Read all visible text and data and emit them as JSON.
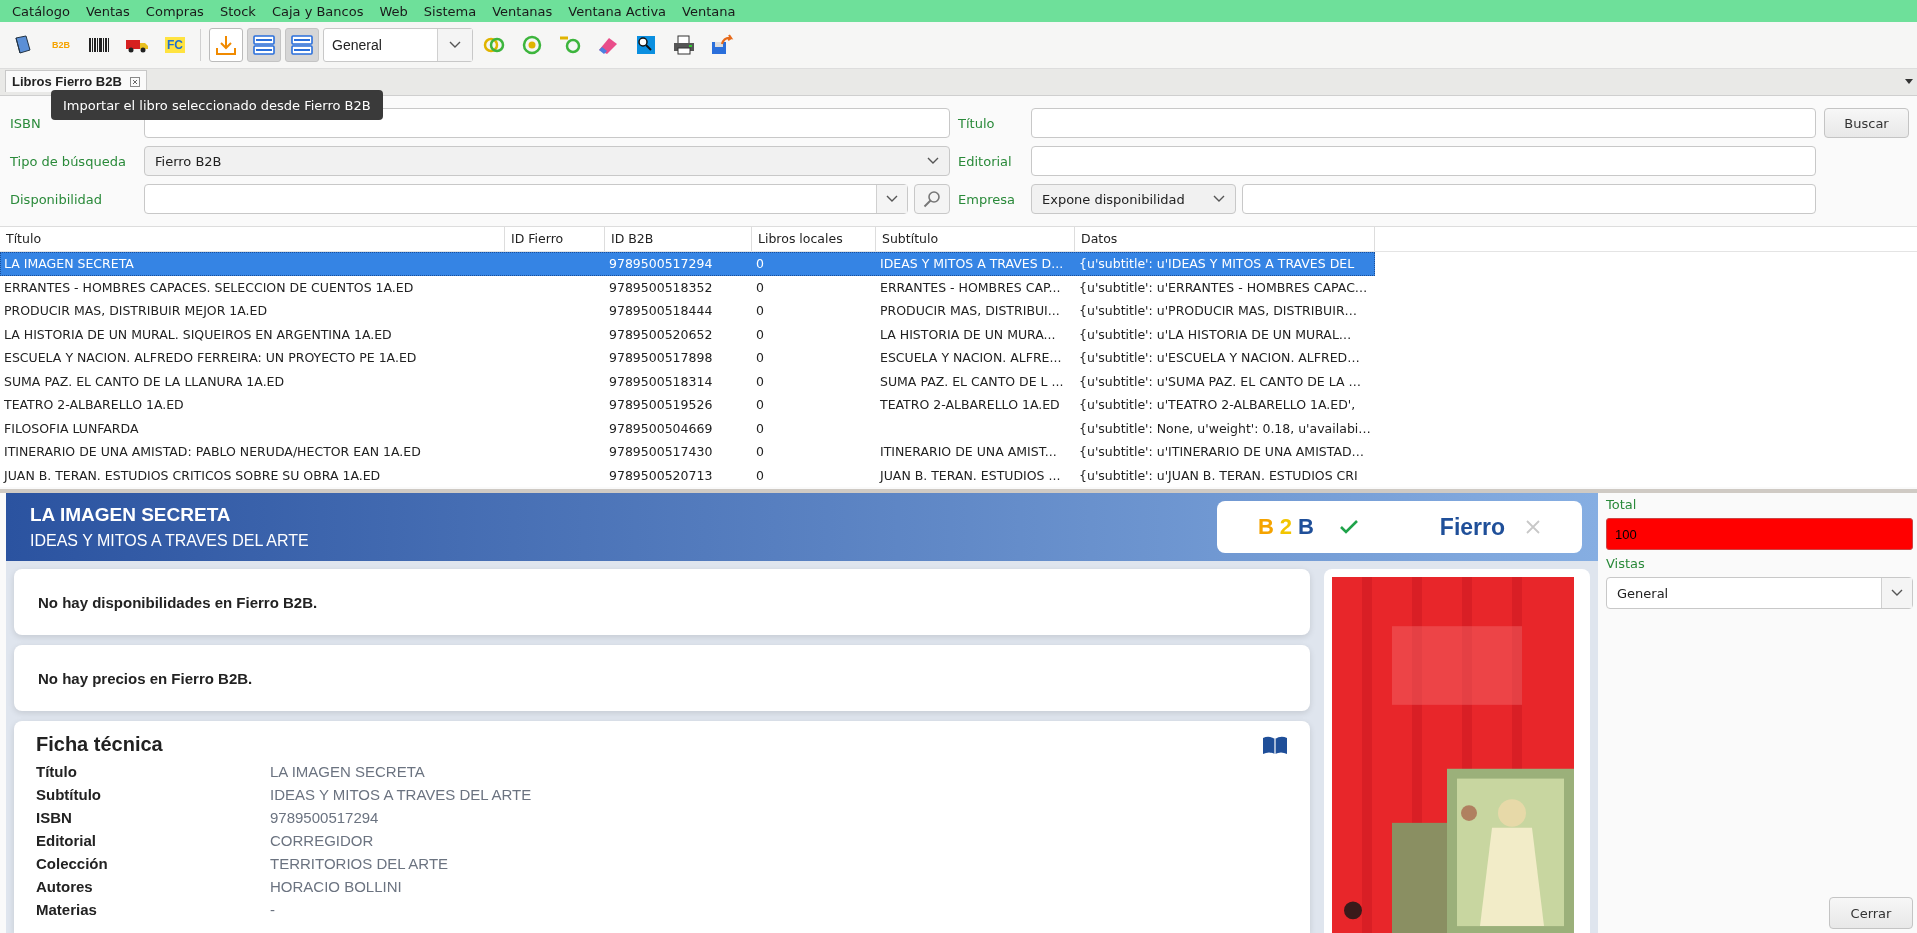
{
  "menu": [
    "Catálogo",
    "Ventas",
    "Compras",
    "Stock",
    "Caja y Bancos",
    "Web",
    "Sistema",
    "Ventanas",
    "Ventana Activa",
    "Ventana"
  ],
  "toolbar": {
    "groups": [
      [
        {
          "kind": "book",
          "pressed": false,
          "hovered": false
        },
        {
          "kind": "b2b",
          "label": "B2B",
          "pressed": false,
          "hovered": false
        },
        {
          "kind": "barcode",
          "pressed": false,
          "hovered": false
        },
        {
          "kind": "truck",
          "pressed": false,
          "hovered": false
        },
        {
          "kind": "fc",
          "label": "FC",
          "pressed": false,
          "hovered": false
        }
      ],
      [
        {
          "kind": "import",
          "pressed": false,
          "hovered": true
        },
        {
          "kind": "rows",
          "pressed": true,
          "hovered": false
        },
        {
          "kind": "rows",
          "pressed": true,
          "hovered": false
        },
        {
          "kind": "combo",
          "value": "General"
        },
        {
          "kind": "rings",
          "pressed": false,
          "hovered": false
        },
        {
          "kind": "target",
          "pressed": false,
          "hovered": false
        },
        {
          "kind": "key",
          "pressed": false,
          "hovered": false
        },
        {
          "kind": "eraser",
          "pressed": false,
          "hovered": false
        },
        {
          "kind": "window-search",
          "pressed": false,
          "hovered": false
        },
        {
          "kind": "printer",
          "pressed": false,
          "hovered": false
        },
        {
          "kind": "export",
          "pressed": false,
          "hovered": false
        }
      ]
    ]
  },
  "tabs": [
    {
      "label": "Libros Fierro B2B",
      "selected": true
    }
  ],
  "tooltip": "Importar el libro seleccionado desde Fierro B2B",
  "form": {
    "isbn": {
      "label": "ISBN"
    },
    "titulo": {
      "label": "Título"
    },
    "buscar": "Buscar",
    "tipo": {
      "label": "Tipo de búsqueda",
      "value": "Fierro B2B"
    },
    "editorial": {
      "label": "Editorial"
    },
    "disponibilidad": {
      "label": "Disponibilidad"
    },
    "empresa": {
      "label": "Empresa",
      "value": "Expone disponibilidad"
    }
  },
  "table": {
    "columns": [
      "Título",
      "ID Fierro",
      "ID B2B",
      "Libros locales",
      "Subtítulo",
      "Datos"
    ],
    "rows": [
      {
        "selected": true,
        "cells": [
          "LA IMAGEN SECRETA",
          "",
          "9789500517294",
          "0",
          "IDEAS Y MITOS A TRAVES D...",
          "{u'subtitle': u'IDEAS Y MITOS A TRAVES DEL"
        ]
      },
      {
        "selected": false,
        "cells": [
          "ERRANTES - HOMBRES CAPACES. SELECCION DE CUENTOS 1A.ED",
          "",
          "9789500518352",
          "0",
          "ERRANTES - HOMBRES CAP...",
          "{u'subtitle': u'ERRANTES - HOMBRES CAPAC…"
        ]
      },
      {
        "selected": false,
        "cells": [
          "PRODUCIR MAS, DISTRIBUIR MEJOR 1A.ED",
          "",
          "9789500518444",
          "0",
          "PRODUCIR MAS, DISTRIBUI...",
          "{u'subtitle': u'PRODUCIR MAS, DISTRIBUIR…"
        ]
      },
      {
        "selected": false,
        "cells": [
          "LA HISTORIA DE UN MURAL. SIQUEIROS EN ARGENTINA 1A.ED",
          "",
          "9789500520652",
          "0",
          "LA HISTORIA DE UN MURA...",
          "{u'subtitle': u'LA HISTORIA DE UN MURAL…"
        ]
      },
      {
        "selected": false,
        "cells": [
          "ESCUELA Y NACION. ALFREDO FERREIRA: UN PROYECTO PE 1A.ED",
          "",
          "9789500517898",
          "0",
          "ESCUELA Y NACION. ALFRE...",
          "{u'subtitle': u'ESCUELA Y NACION. ALFRED…"
        ]
      },
      {
        "selected": false,
        "cells": [
          "SUMA PAZ. EL CANTO DE LA LLANURA 1A.ED",
          "",
          "9789500518314",
          "0",
          "SUMA PAZ. EL CANTO DE L ...",
          "{u'subtitle': u'SUMA PAZ. EL CANTO DE LA …"
        ]
      },
      {
        "selected": false,
        "cells": [
          "TEATRO 2-ALBARELLO 1A.ED",
          "",
          "9789500519526",
          "0",
          "TEATRO 2-ALBARELLO 1A.ED",
          "{u'subtitle': u'TEATRO 2-ALBARELLO 1A.ED',"
        ]
      },
      {
        "selected": false,
        "cells": [
          "FILOSOFIA LUNFARDA",
          "",
          "9789500504669",
          "0",
          "",
          "{u'subtitle': None, u'weight': 0.18, u'availabi…"
        ]
      },
      {
        "selected": false,
        "cells": [
          "ITINERARIO DE UNA AMISTAD: PABLO NERUDA/HECTOR EAN 1A.ED",
          "",
          "9789500517430",
          "0",
          "ITINERARIO DE UNA AMIST...",
          "{u'subtitle': u'ITINERARIO DE UNA AMISTAD…"
        ]
      },
      {
        "selected": false,
        "cells": [
          "JUAN B. TERAN. ESTUDIOS CRITICOS SOBRE SU OBRA 1A.ED",
          "",
          "9789500520713",
          "0",
          "JUAN B. TERAN. ESTUDIOS ...",
          "{u'subtitle': u'JUAN B. TERAN. ESTUDIOS CRI"
        ]
      }
    ]
  },
  "detail": {
    "title": "LA IMAGEN SECRETA",
    "subtitle": "IDEAS Y MITOS A TRAVES DEL ARTE",
    "sources": [
      {
        "kind": "b2b",
        "label": "B2B",
        "available": true
      },
      {
        "kind": "fierro",
        "label": "Fierro",
        "available": false
      }
    ],
    "messages": [
      "No hay disponibilidades en Fierro B2B.",
      "No hay precios en Fierro B2B."
    ],
    "ficha": {
      "title": "Ficha técnica",
      "rows": [
        {
          "label": "Título",
          "value": "LA IMAGEN SECRETA"
        },
        {
          "label": "Subtítulo",
          "value": "IDEAS Y MITOS A TRAVES DEL ARTE"
        },
        {
          "label": "ISBN",
          "value": "9789500517294"
        },
        {
          "label": "Editorial",
          "value": "CORREGIDOR"
        },
        {
          "label": "Colección",
          "value": "TERRITORIOS DEL ARTE"
        },
        {
          "label": "Autores",
          "value": "HORACIO BOLLINI"
        },
        {
          "label": "Materias",
          "value": "-"
        }
      ]
    }
  },
  "side": {
    "total_label": "Total",
    "total": "100",
    "vistas_label": "Vistas",
    "vistas": "General",
    "close": "Cerrar"
  }
}
